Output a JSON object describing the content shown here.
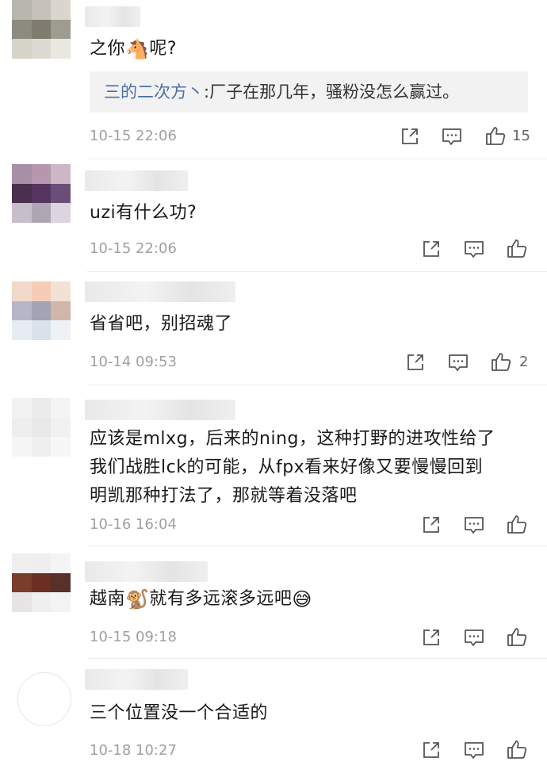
{
  "comments": [
    {
      "text": "之你",
      "emoji_mid": "🐴",
      "text_after": "呢?",
      "reply_name": "三的二次方丶",
      "reply_text": ":厂子在那几年，骚粉没怎么赢过。",
      "time": "10-15 22:06",
      "like_count": "15"
    },
    {
      "text": "uzi有什么功?",
      "time": "10-15 22:06",
      "like_count": ""
    },
    {
      "text": "省省吧，别招魂了",
      "time": "10-14 09:53",
      "like_count": "2"
    },
    {
      "lines": [
        "应该是mlxg，后来的ning，这种打野的进攻性给了",
        "我们战胜lck的可能，从fpx看来好像又要慢慢回到",
        "明凯那种打法了，那就等着没落吧"
      ],
      "time": "10-16 16:04",
      "like_count": ""
    },
    {
      "text": "越南",
      "emoji_mid": "🐒",
      "text_after": "就有多远滚多远吧",
      "emoji_end": "😅",
      "time": "10-15 09:18",
      "like_count": ""
    },
    {
      "text": "三个位置没一个合适的",
      "time": "10-18 10:27",
      "like_count": ""
    }
  ],
  "icons": {
    "share": "share-icon",
    "comment": "comment-icon",
    "like": "like-icon"
  },
  "colors": {
    "reply_name": "#4a6fa5",
    "time": "#a0a0a0",
    "icon": "#555555"
  }
}
